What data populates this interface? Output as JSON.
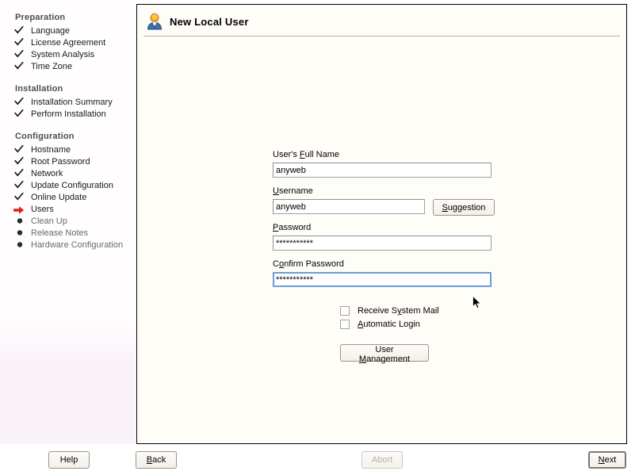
{
  "sidebar": {
    "groups": [
      {
        "title": "Preparation",
        "items": [
          {
            "label": "Language",
            "state": "done"
          },
          {
            "label": "License Agreement",
            "state": "done"
          },
          {
            "label": "System Analysis",
            "state": "done"
          },
          {
            "label": "Time Zone",
            "state": "done"
          }
        ]
      },
      {
        "title": "Installation",
        "items": [
          {
            "label": "Installation Summary",
            "state": "done"
          },
          {
            "label": "Perform Installation",
            "state": "done"
          }
        ]
      },
      {
        "title": "Configuration",
        "items": [
          {
            "label": "Hostname",
            "state": "done"
          },
          {
            "label": "Root Password",
            "state": "done"
          },
          {
            "label": "Network",
            "state": "done"
          },
          {
            "label": "Update Configuration",
            "state": "done"
          },
          {
            "label": "Online Update",
            "state": "done"
          },
          {
            "label": "Users",
            "state": "current"
          },
          {
            "label": "Clean Up",
            "state": "pending"
          },
          {
            "label": "Release Notes",
            "state": "pending"
          },
          {
            "label": "Hardware Configuration",
            "state": "pending"
          }
        ]
      }
    ]
  },
  "panel": {
    "title": "New Local User",
    "icon": "user-icon"
  },
  "form": {
    "full_name": {
      "label_pre": "User's ",
      "label_mn": "F",
      "label_post": "ull Name",
      "value": "anyweb"
    },
    "username": {
      "label_mn": "U",
      "label_post": "sername",
      "value": "anyweb"
    },
    "suggestion_button": {
      "label_mn": "S",
      "label_post": "uggestion"
    },
    "password": {
      "label_mn": "P",
      "label_post": "assword",
      "value": "***********"
    },
    "confirm_password": {
      "label_pre": "C",
      "label_mn": "o",
      "label_post": "nfirm Password",
      "value": "***********",
      "focused": true
    },
    "receive_mail": {
      "label_pre": "Receive S",
      "label_mn": "y",
      "label_post": "stem Mail",
      "checked": false
    },
    "auto_login": {
      "label_mn": "A",
      "label_post": "utomatic Login",
      "checked": false
    },
    "user_management_button": {
      "label_pre": "User ",
      "label_mn": "M",
      "label_post": "anagement"
    }
  },
  "bottom": {
    "help": {
      "label": "Help"
    },
    "back": {
      "label_mn": "B",
      "label_post": "ack"
    },
    "abort": {
      "label": "Abort",
      "disabled": true
    },
    "next": {
      "label_mn": "N",
      "label_post": "ext",
      "default": true
    }
  },
  "colors": {
    "panel_bg": "#fffdf8",
    "sidebar_bg": "#fffdfd",
    "current_arrow": "#e02020",
    "focus_border": "#6a9fd4",
    "icon_head": "#f0a81e",
    "icon_body": "#3f6fa8"
  }
}
